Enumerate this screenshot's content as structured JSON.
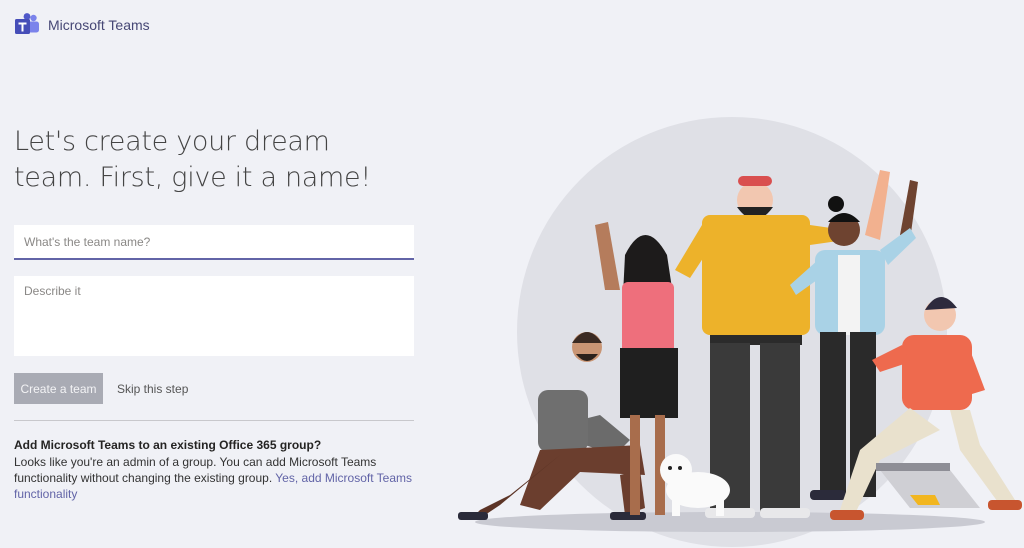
{
  "app": {
    "name": "Microsoft Teams"
  },
  "headline": "Let's create your dream team. First, give it a name!",
  "form": {
    "name_placeholder": "What's the team name?",
    "name_value": "",
    "description_placeholder": "Describe it",
    "description_value": "",
    "create_label": "Create a team",
    "skip_label": "Skip this step"
  },
  "group": {
    "title": "Add Microsoft Teams to an existing Office 365 group?",
    "text": "Looks like you're an admin of a group. You can add Microsoft Teams functionality without changing the existing group. ",
    "link_label": "Yes, add Microsoft Teams functionality"
  },
  "colors": {
    "brand": "#6264a7",
    "background": "#f0f1f6",
    "button_disabled": "#a9abb4"
  },
  "icons": [
    "teams-logo-icon"
  ]
}
